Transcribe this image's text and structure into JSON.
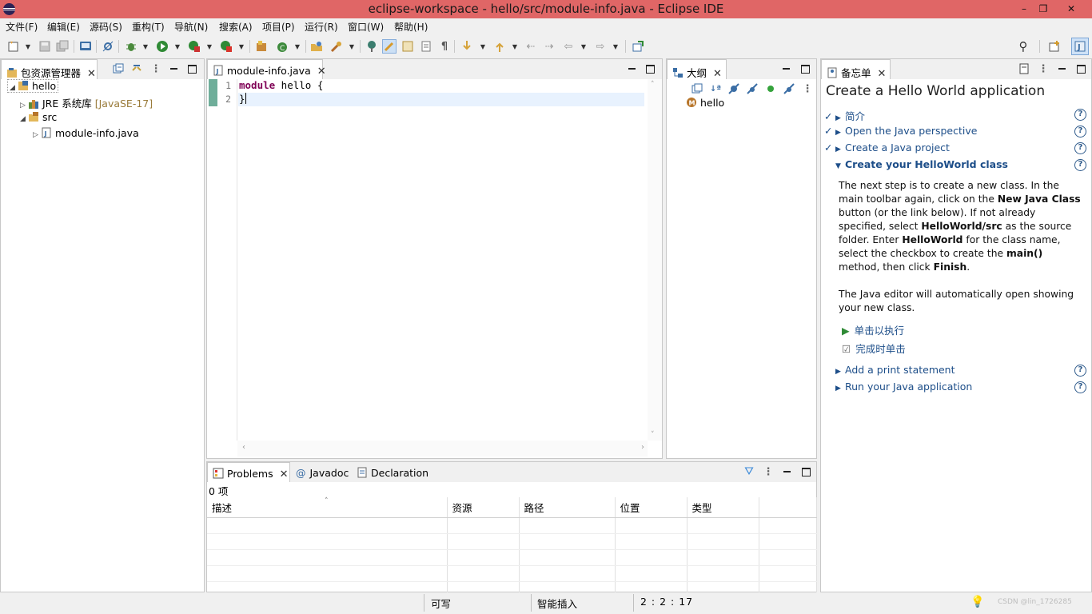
{
  "window": {
    "title": "eclipse-workspace - hello/src/module-info.java - Eclipse IDE",
    "minimize": "–",
    "restore": "❐",
    "close": "✕"
  },
  "menu": [
    "文件(F)",
    "编辑(E)",
    "源码(S)",
    "重构(T)",
    "导航(N)",
    "搜索(A)",
    "项目(P)",
    "运行(R)",
    "窗口(W)",
    "帮助(H)"
  ],
  "package_explorer": {
    "tab": "包资源管理器",
    "tree": [
      {
        "label": "hello",
        "suffix": ""
      },
      {
        "label": "JRE 系统库 ",
        "suffix": "[JavaSE-17]"
      },
      {
        "label": "src",
        "suffix": ""
      },
      {
        "label": "module-info.java",
        "suffix": ""
      }
    ]
  },
  "editor": {
    "tab": "module-info.java",
    "lines": [
      {
        "no": "1",
        "kw": "module",
        "rest": " hello {"
      },
      {
        "no": "2",
        "kw": "",
        "rest": "}"
      }
    ]
  },
  "outline": {
    "tab": "大纲",
    "items": [
      "hello"
    ]
  },
  "cheatsheet": {
    "tab": "备忘单",
    "title": "Create a Hello World application",
    "steps": [
      {
        "label": "简介"
      },
      {
        "label": "Open the Java perspective"
      },
      {
        "label": "Create a Java project"
      },
      {
        "label": "Create your HelloWorld class"
      }
    ],
    "para1": {
      "p1": "The next step is to create a new class. In the main toolbar again, click on the ",
      "b1": "New Java Class",
      "p2": " button (or the link below). If not already specified, select ",
      "b2": "HelloWorld/src",
      "p3": " as the source folder. Enter ",
      "b3": "HelloWorld",
      "p4": " for the class name, select the checkbox to create the ",
      "b4": "main()",
      "p5": " method, then click ",
      "b5": "Finish",
      "p6": "."
    },
    "para2": "The Java editor will automatically open showing your new class.",
    "actions": {
      "run": "单击以执行",
      "complete": "完成时单击"
    },
    "later_steps": [
      "Add a print statement",
      "Run your Java application"
    ]
  },
  "problems": {
    "tabs": [
      "Problems",
      "Javadoc",
      "Declaration"
    ],
    "count": "0 项",
    "columns": [
      "描述",
      "资源",
      "路径",
      "位置",
      "类型"
    ]
  },
  "status": {
    "writable": "可写",
    "insert_mode": "智能插入",
    "position": "2 : 2 : 17",
    "watermark": "CSDN @lin_1726285"
  },
  "colors": {
    "titlebar": "#e06666",
    "keyword": "#7f0055",
    "link": "#1d4e89"
  }
}
